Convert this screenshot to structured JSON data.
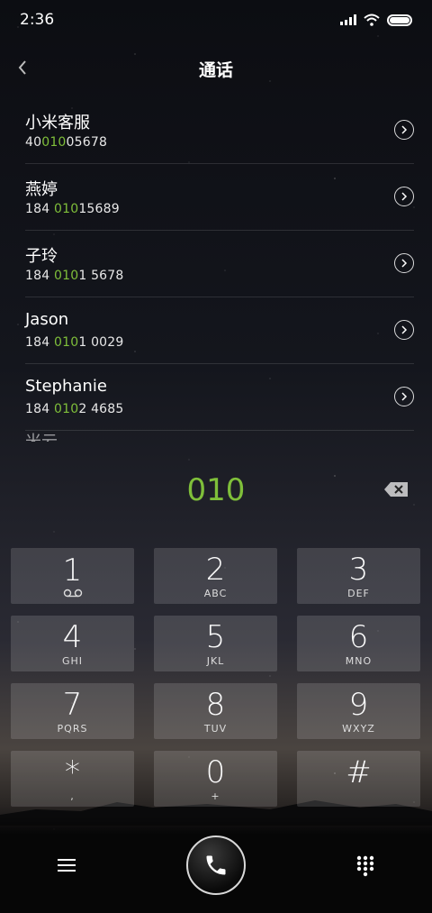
{
  "status": {
    "time": "2:36"
  },
  "header": {
    "title": "通话"
  },
  "contacts": [
    {
      "name": "小米客服",
      "num_pre": "40",
      "num_hl": "010",
      "num_post": "05678"
    },
    {
      "name": "燕婷",
      "num_pre": "184 ",
      "num_hl": "010",
      "num_post": "15689"
    },
    {
      "name": "子玲",
      "num_pre": "184 ",
      "num_hl": "010",
      "num_post": "1 5678"
    },
    {
      "name": "Jason",
      "num_pre": "184 ",
      "num_hl": "010",
      "num_post": "1 0029"
    },
    {
      "name": "Stephanie",
      "num_pre": "184 ",
      "num_hl": "010",
      "num_post": "2 4685"
    },
    {
      "name": "米云"
    }
  ],
  "entry": {
    "digits": "010"
  },
  "keypad": [
    {
      "digit": "1",
      "letters": ""
    },
    {
      "digit": "2",
      "letters": "ABC"
    },
    {
      "digit": "3",
      "letters": "DEF"
    },
    {
      "digit": "4",
      "letters": "GHI"
    },
    {
      "digit": "5",
      "letters": "JKL"
    },
    {
      "digit": "6",
      "letters": "MNO"
    },
    {
      "digit": "7",
      "letters": "PQRS"
    },
    {
      "digit": "8",
      "letters": "TUV"
    },
    {
      "digit": "9",
      "letters": "WXYZ"
    },
    {
      "digit": "*",
      "letters": ","
    },
    {
      "digit": "0",
      "letters": "+"
    },
    {
      "digit": "#",
      "letters": ""
    }
  ],
  "colors": {
    "accent": "#7fbf3a"
  }
}
